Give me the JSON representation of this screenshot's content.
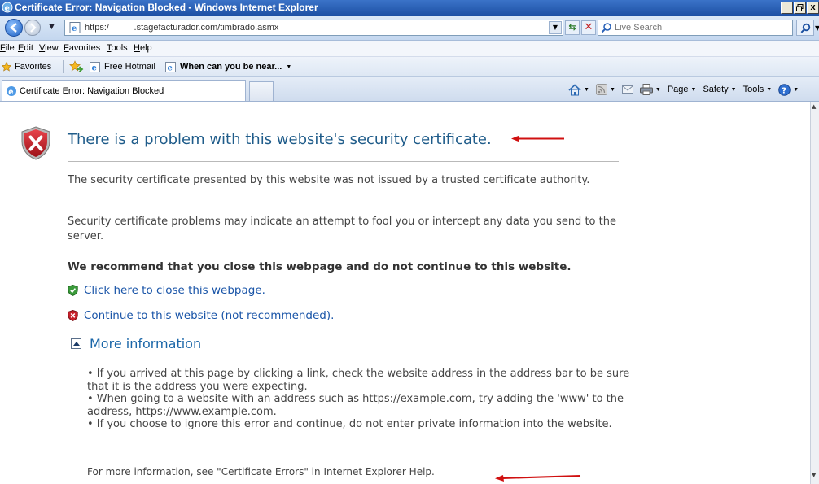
{
  "window": {
    "title": "Certificate Error: Navigation Blocked - Windows Internet Explorer",
    "controls": {
      "minimize": "_",
      "restore": "̸",
      "close": "x"
    }
  },
  "address_bar": {
    "url": "https:/          .stagefacturador.com/timbrado.asmx"
  },
  "search": {
    "placeholder": "Live Search"
  },
  "menu": [
    "File",
    "Edit",
    "View",
    "Favorites",
    "Tools",
    "Help"
  ],
  "favorites_bar": {
    "favorites_label": "Favorites",
    "links": [
      "Free Hotmail",
      "When can you be near..."
    ]
  },
  "tab": {
    "active_label": "Certificate Error: Navigation Blocked"
  },
  "command_bar": {
    "page_label": "Page",
    "safety_label": "Safety",
    "tools_label": "Tools"
  },
  "content": {
    "title": "There is a problem with this website's security certificate.",
    "para1": "The security certificate presented by this website was not issued by a trusted certificate authority.",
    "para2": "Security certificate problems may indicate an attempt to fool you or intercept any data you send to the server.",
    "recommend": "We recommend that you close this webpage and do not continue to this website.",
    "close_link": "Click here to close this webpage.",
    "continue_link": "Continue to this website (not recommended).",
    "more_info": "More information",
    "bullets": [
      "• If you arrived at this page by clicking a link, check the website address in the address bar to be sure that it is the address you were expecting.",
      "• When going to a website with an address such as https://example.com, try adding the 'www' to the address, https://www.example.com.",
      "• If you choose to ignore this error and continue, do not enter private information into the website."
    ],
    "help": "For more information, see \"Certificate Errors\" in Internet Explorer Help."
  },
  "colors": {
    "title_blue": "#1f5c8a",
    "link_blue": "#1a55a8",
    "shield_red": "#c8202a",
    "shield_green": "#3a9a3a",
    "arrow_red": "#d01010"
  }
}
